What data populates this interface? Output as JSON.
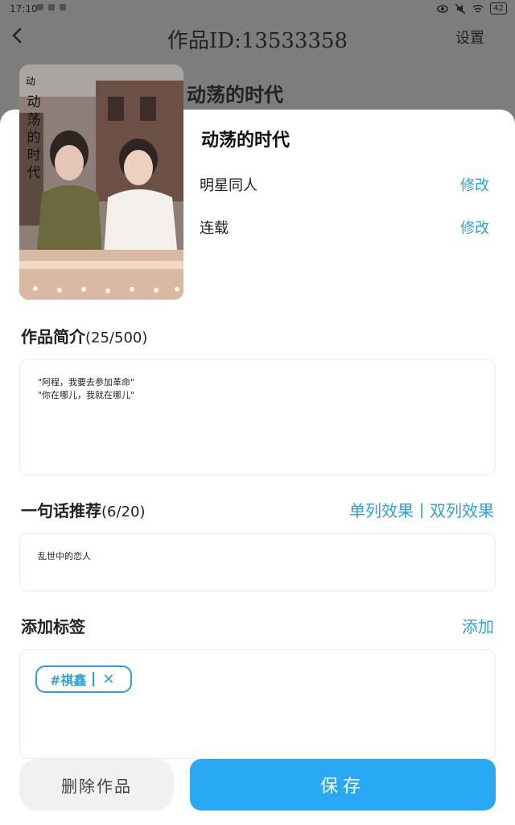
{
  "status": {
    "time": "17:10",
    "battery": "42"
  },
  "header": {
    "title": "作品ID:13533358",
    "settings": "设置"
  },
  "behind_title": "动荡的时代",
  "cover": {
    "vertical_title": "动荡的时代",
    "top_char": "动"
  },
  "work": {
    "name": "动荡的时代",
    "category": "明星同人",
    "category_edit": "修改",
    "status": "连载",
    "status_edit": "修改"
  },
  "intro": {
    "title": "作品简介",
    "count": "(25/500)",
    "line1": "\"阿程，我要去参加革命\"",
    "line2": "\"你在哪儿，我就在哪儿\""
  },
  "recommend": {
    "title": "一句话推荐",
    "count": "(6/20)",
    "link": "单列效果丨双列效果",
    "text": "乱世中的恋人"
  },
  "tags": {
    "title": "添加标签",
    "add": "添加",
    "items": [
      {
        "label": "#祺鑫"
      }
    ]
  },
  "buttons": {
    "delete": "删除作品",
    "save": "保存"
  }
}
